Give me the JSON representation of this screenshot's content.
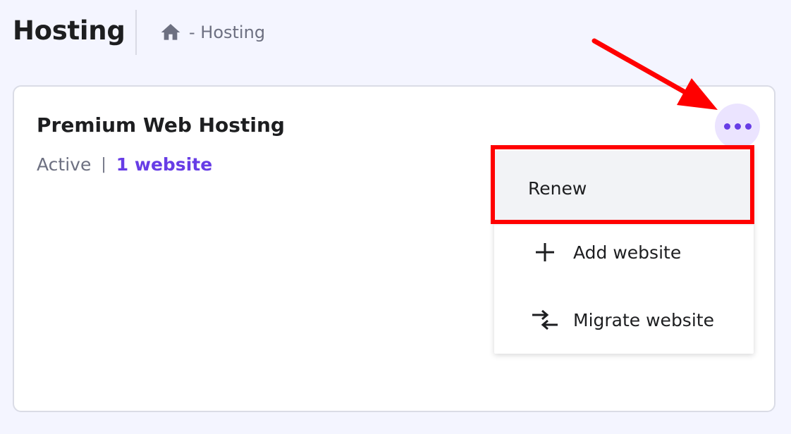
{
  "header": {
    "title": "Hosting",
    "breadcrumb": {
      "home_icon": "home-icon",
      "trail": "- Hosting"
    }
  },
  "card": {
    "title": "Premium Web Hosting",
    "status": "Active",
    "separator": "|",
    "website_link": "1 website",
    "more_icon": "more-horizontal-icon"
  },
  "menu": {
    "items": [
      {
        "label": "Renew",
        "icon": ""
      },
      {
        "label": "Add website",
        "icon": "plus-icon"
      },
      {
        "label": "Migrate website",
        "icon": "migrate-arrows-icon"
      }
    ]
  },
  "colors": {
    "page_background": "#f4f5ff",
    "accent": "#673de6",
    "accent_soft": "#ebe4ff",
    "muted_text": "#6d7081",
    "annotation": "#ff0000"
  }
}
